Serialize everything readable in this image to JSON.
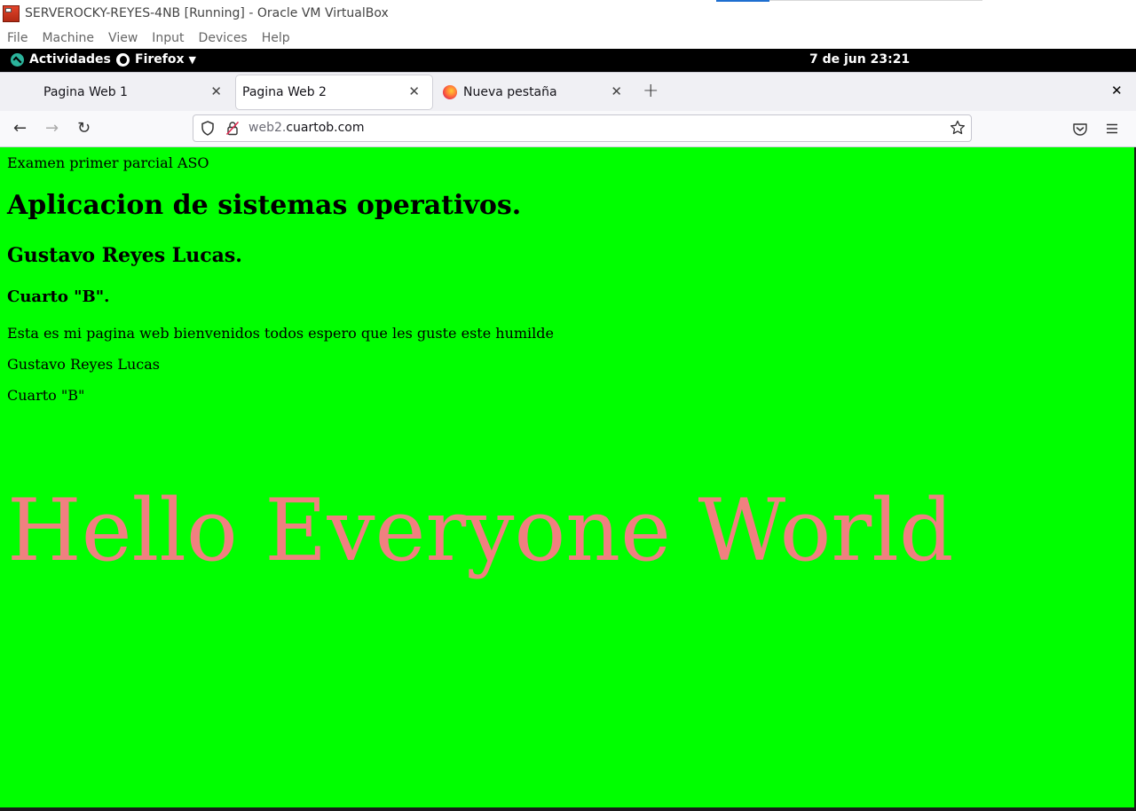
{
  "vbox": {
    "title": "SERVEROCKY-REYES-4NB [Running] - Oracle VM VirtualBox",
    "menu": [
      "File",
      "Machine",
      "View",
      "Input",
      "Devices",
      "Help"
    ]
  },
  "gnome": {
    "activities": "Actividades",
    "app_name": "Firefox",
    "clock": "7 de jun  23:21"
  },
  "tabs": [
    {
      "label": "Pagina Web 1",
      "active": false
    },
    {
      "label": "Pagina Web 2",
      "active": true
    },
    {
      "label": "Nueva pestaña",
      "active": false
    }
  ],
  "url": {
    "subdomain": "web2.",
    "domain": "cuartob.com"
  },
  "page": {
    "top_text": "Examen primer parcial ASO",
    "h1": "Aplicacion de sistemas operativos.",
    "h2": "Gustavo Reyes Lucas.",
    "h3": "Cuarto \"B\".",
    "p1": "Esta es mi pagina web bienvenidos todos espero que les guste este humilde",
    "p2": "Gustavo Reyes Lucas",
    "p3": "Cuarto \"B\"",
    "hero": "Hello Everyone World",
    "background_color": "#00ff00",
    "hero_color": "#f08080"
  },
  "icons": {
    "back": "arrow-left-icon",
    "forward": "arrow-right-icon",
    "reload": "reload-icon",
    "shield": "tracking-shield-icon",
    "lock": "insecure-lock-icon",
    "star": "bookmark-star-icon",
    "pocket": "pocket-icon",
    "menu": "hamburger-menu-icon"
  }
}
